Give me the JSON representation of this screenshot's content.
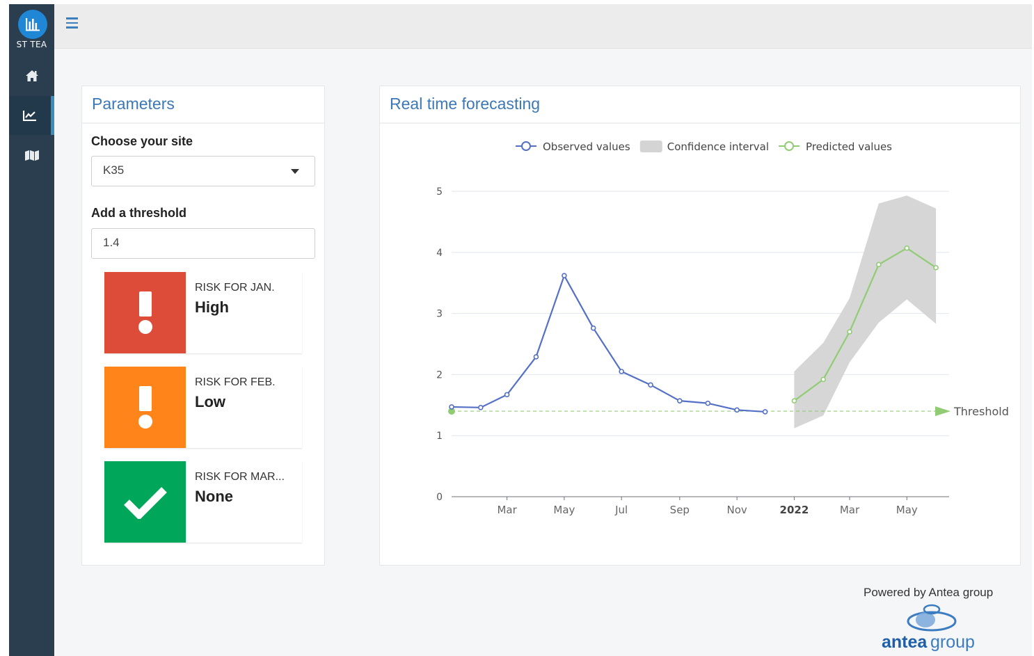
{
  "app": {
    "brand": "ST TEA"
  },
  "sidebar": {
    "items": [
      {
        "name": "home",
        "icon": "home-icon",
        "active": false
      },
      {
        "name": "forecast",
        "icon": "line-chart-icon",
        "active": true
      },
      {
        "name": "map",
        "icon": "map-icon",
        "active": false
      }
    ]
  },
  "topbar": {
    "menu_icon": "hamburger-icon"
  },
  "parameters": {
    "title": "Parameters",
    "site_label": "Choose your site",
    "site_value": "K35",
    "threshold_label": "Add a threshold",
    "threshold_value": "1.4",
    "risks": [
      {
        "label": "Risk for Jan.",
        "value": "High",
        "color": "#dd4b39",
        "icon": "exclamation-icon"
      },
      {
        "label": "Risk for Feb.",
        "value": "Low",
        "color": "#ff851b",
        "icon": "exclamation-icon"
      },
      {
        "label": "Risk for Mar...",
        "value": "None",
        "color": "#00a65a",
        "icon": "check-icon"
      }
    ]
  },
  "forecast": {
    "title": "Real time forecasting"
  },
  "chart_data": {
    "type": "line",
    "legend": [
      {
        "name": "Observed values",
        "color": "#5470c6",
        "kind": "line"
      },
      {
        "name": "Confidence interval",
        "color": "#d4d4d4",
        "kind": "area"
      },
      {
        "name": "Predicted values",
        "color": "#91cc75",
        "kind": "line"
      }
    ],
    "legend_placement": "top-center",
    "ylim": [
      0,
      5
    ],
    "yticks": [
      "0",
      "1",
      "2",
      "3",
      "4",
      "5"
    ],
    "xlim": [
      "2021-01-01",
      "2022-06-15"
    ],
    "xticks": [
      {
        "label": "Mar",
        "date": "2021-03-01",
        "bold": false
      },
      {
        "label": "May",
        "date": "2021-05-01",
        "bold": false
      },
      {
        "label": "Jul",
        "date": "2021-07-01",
        "bold": false
      },
      {
        "label": "Sep",
        "date": "2021-09-01",
        "bold": false
      },
      {
        "label": "Nov",
        "date": "2021-11-01",
        "bold": false
      },
      {
        "label": "2022",
        "date": "2022-01-01",
        "bold": true
      },
      {
        "label": "Mar",
        "date": "2022-03-01",
        "bold": false
      },
      {
        "label": "May",
        "date": "2022-05-01",
        "bold": false
      }
    ],
    "grid": true,
    "series": [
      {
        "name": "Observed values",
        "color": "#5470c6",
        "points": [
          {
            "x": "2021-01-01",
            "y": 1.47
          },
          {
            "x": "2021-02-01",
            "y": 1.46
          },
          {
            "x": "2021-03-01",
            "y": 1.67
          },
          {
            "x": "2021-04-01",
            "y": 2.29
          },
          {
            "x": "2021-05-01",
            "y": 3.62
          },
          {
            "x": "2021-06-01",
            "y": 2.76
          },
          {
            "x": "2021-07-01",
            "y": 2.05
          },
          {
            "x": "2021-08-01",
            "y": 1.83
          },
          {
            "x": "2021-09-01",
            "y": 1.57
          },
          {
            "x": "2021-10-01",
            "y": 1.53
          },
          {
            "x": "2021-11-01",
            "y": 1.42
          },
          {
            "x": "2021-12-01",
            "y": 1.39
          }
        ]
      },
      {
        "name": "Predicted values",
        "color": "#91cc75",
        "points": [
          {
            "x": "2022-01-01",
            "y": 1.57
          },
          {
            "x": "2022-02-01",
            "y": 1.92
          },
          {
            "x": "2022-03-01",
            "y": 2.7
          },
          {
            "x": "2022-04-01",
            "y": 3.8
          },
          {
            "x": "2022-05-01",
            "y": 4.07
          },
          {
            "x": "2022-06-01",
            "y": 3.75
          }
        ]
      }
    ],
    "confidence_interval": {
      "name": "Confidence interval",
      "color": "#d4d4d4",
      "points": [
        {
          "x": "2022-01-01",
          "low": 1.12,
          "high": 2.05
        },
        {
          "x": "2022-02-01",
          "low": 1.33,
          "high": 2.52
        },
        {
          "x": "2022-03-01",
          "low": 2.2,
          "high": 3.25
        },
        {
          "x": "2022-04-01",
          "low": 2.85,
          "high": 4.8
        },
        {
          "x": "2022-05-01",
          "low": 3.23,
          "high": 4.93
        },
        {
          "x": "2022-06-01",
          "low": 2.83,
          "high": 4.72
        }
      ]
    },
    "threshold": {
      "label": "Threshold",
      "value": 1.4,
      "color": "#91cc75"
    }
  },
  "footer": {
    "powered_by": "Powered by Antea group",
    "logo_text_1": "antea",
    "logo_text_2": "group"
  }
}
